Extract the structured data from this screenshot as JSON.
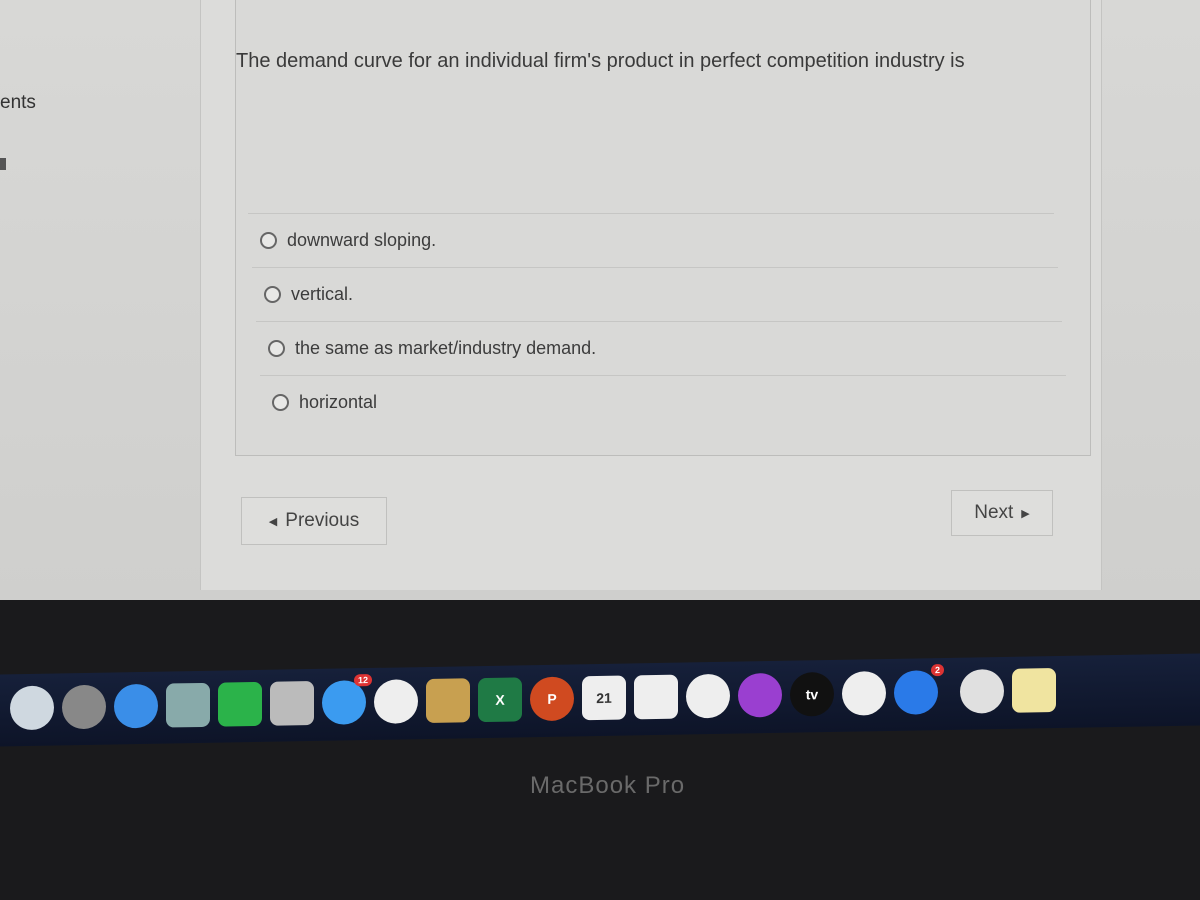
{
  "sidebar": {
    "partial_label": "ents"
  },
  "question": {
    "text": "The demand curve for an individual firm's product in perfect competition industry is",
    "options": [
      "downward sloping.",
      "vertical.",
      "the same as market/industry demand.",
      "horizontal"
    ]
  },
  "nav": {
    "previous": "Previous",
    "next": "Next"
  },
  "dock": {
    "apps": [
      {
        "name": "finder",
        "color": "#cfd8e0"
      },
      {
        "name": "launchpad",
        "color": "#888"
      },
      {
        "name": "safari",
        "color": "#3a8ee8"
      },
      {
        "name": "preview",
        "color": "#8aa"
      },
      {
        "name": "facetime",
        "color": "#2bb34a"
      },
      {
        "name": "maps",
        "color": "#bbb"
      },
      {
        "name": "messages",
        "color": "#3b9bf0",
        "badge": "12"
      },
      {
        "name": "photos",
        "color": "#eee"
      },
      {
        "name": "notes-folder",
        "color": "#c8a050"
      },
      {
        "name": "excel",
        "color": "#1f7a45",
        "label": "X"
      },
      {
        "name": "powerpoint",
        "color": "#d04a20",
        "label": "P"
      },
      {
        "name": "calendar",
        "color": "#eee",
        "label": "21"
      },
      {
        "name": "reminders",
        "color": "#eee"
      },
      {
        "name": "music",
        "color": "#eee"
      },
      {
        "name": "podcasts",
        "color": "#9a3fd0"
      },
      {
        "name": "apple-tv",
        "color": "#111",
        "label": "tv"
      },
      {
        "name": "news",
        "color": "#eee"
      },
      {
        "name": "app-store",
        "color": "#2a7ae8",
        "badge": "2"
      },
      {
        "name": "chrome",
        "color": "#e0e0e0"
      },
      {
        "name": "notes",
        "color": "#f0e4a0"
      }
    ]
  },
  "bezel_label": "MacBook Pro"
}
